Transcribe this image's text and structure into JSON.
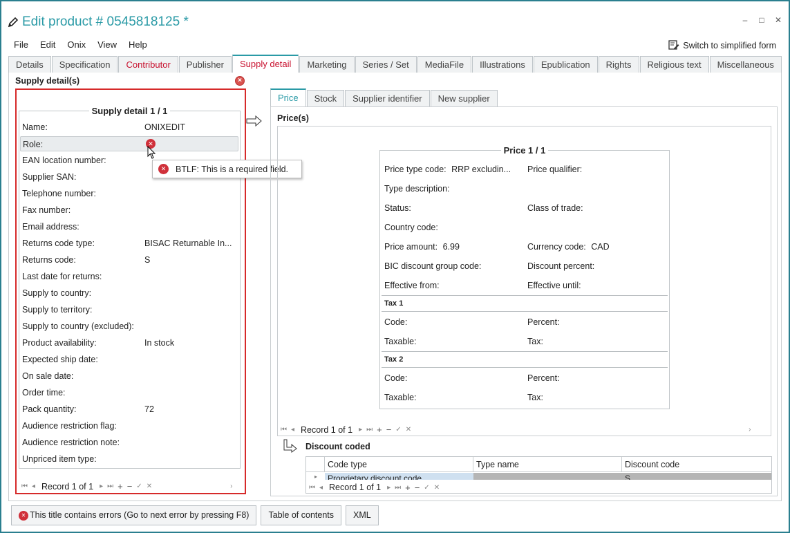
{
  "window": {
    "title": "Edit product # 0545818125 *",
    "controls": [
      "–",
      "□",
      "✕"
    ]
  },
  "menu": [
    "File",
    "Edit",
    "Onix",
    "View",
    "Help"
  ],
  "switch_label": "Switch to simplified form",
  "tabs": [
    "Details",
    "Specification",
    "Contributor",
    "Publisher",
    "Supply detail",
    "Marketing",
    "Series / Set",
    "MediaFile",
    "Illustrations",
    "Epublication",
    "Rights",
    "Religious text",
    "Miscellaneous"
  ],
  "supply": {
    "section_title": "Supply detail(s)",
    "legend": "Supply detail 1 / 1",
    "fields": [
      {
        "label": "Name:",
        "value": "ONIXEDIT"
      },
      {
        "label": "Role:",
        "value": ""
      },
      {
        "label": "EAN location number:",
        "value": ""
      },
      {
        "label": "Supplier SAN:",
        "value": ""
      },
      {
        "label": "Telephone number:",
        "value": ""
      },
      {
        "label": "Fax number:",
        "value": ""
      },
      {
        "label": "Email address:",
        "value": ""
      },
      {
        "label": "Returns code type:",
        "value": "BISAC Returnable In..."
      },
      {
        "label": "Returns code:",
        "value": "S"
      },
      {
        "label": "Last date for returns:",
        "value": ""
      },
      {
        "label": "Supply to country:",
        "value": ""
      },
      {
        "label": "Supply to territory:",
        "value": ""
      },
      {
        "label": "Supply to country (excluded):",
        "value": ""
      },
      {
        "label": "Product availability:",
        "value": "In stock"
      },
      {
        "label": "Expected ship date:",
        "value": ""
      },
      {
        "label": "On sale date:",
        "value": ""
      },
      {
        "label": "Order time:",
        "value": ""
      },
      {
        "label": "Pack quantity:",
        "value": "72"
      },
      {
        "label": "Audience restriction flag:",
        "value": ""
      },
      {
        "label": "Audience restriction note:",
        "value": ""
      },
      {
        "label": "Unpriced item type:",
        "value": ""
      }
    ],
    "tooltip": "BTLF: This is a required field.",
    "record": "Record 1 of 1"
  },
  "subtabs": [
    "Price",
    "Stock",
    "Supplier identifier",
    "New supplier"
  ],
  "price": {
    "section_title": "Price(s)",
    "legend": "Price 1 / 1",
    "price_type_label": "Price type code:",
    "price_type_value": "RRP excludin...",
    "price_qualifier": "Price qualifier:",
    "type_description": "Type description:",
    "status": "Status:",
    "class_of_trade": "Class of trade:",
    "country_code": "Country code:",
    "price_amount_label": "Price amount:",
    "price_amount_value": "6.99",
    "currency_label": "Currency code:",
    "currency_value": "CAD",
    "bic_discount": "BIC discount group code:",
    "discount_percent": "Discount percent:",
    "effective_from": "Effective from:",
    "effective_until": "Effective until:",
    "tax1": "Tax 1",
    "tax2": "Tax 2",
    "code": "Code:",
    "percent": "Percent:",
    "taxable": "Taxable:",
    "tax": "Tax:",
    "record": "Record 1 of 1"
  },
  "discount": {
    "section_title": "Discount coded",
    "columns": [
      "Code type",
      "Type name",
      "Discount code"
    ],
    "row_code_type": "Proprietary discount code",
    "row_discount_code": "S",
    "record": "Record 1 of 1"
  },
  "bottom": {
    "errors": "This title contains errors (Go to next error by pressing F8)",
    "toc": "Table of contents",
    "xml": "XML"
  },
  "colors": {
    "accent": "#2a9aa6",
    "error": "#d62a2a"
  }
}
